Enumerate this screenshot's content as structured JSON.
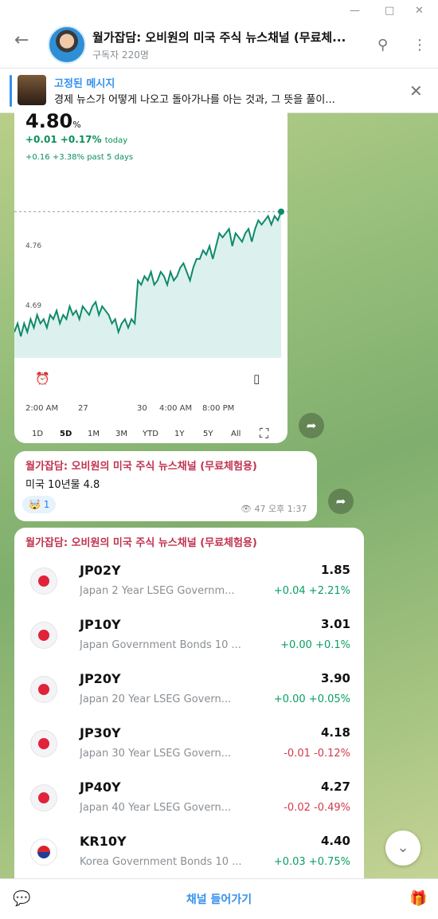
{
  "header": {
    "title": "월가잡담: 오비원의 미국 주식 뉴스채널 (무료체...",
    "subscribers": "구독자 220명"
  },
  "pinned": {
    "title": "고정된 메시지",
    "text": "경제 뉴스가 어떻게 나오고 돌아가나를 아는 것과, 그 뜻을 풀이..."
  },
  "chart_card": {
    "value": "4.80",
    "unit": "%",
    "today_change": "+0.01",
    "today_pct": "+0.17%",
    "today_label": "today",
    "past_change": "+0.16",
    "past_pct": "+3.38%",
    "past_label": "past 5 days",
    "periods": [
      "1D",
      "5D",
      "1M",
      "3M",
      "YTD",
      "1Y",
      "5Y",
      "All"
    ],
    "active_period": "5D"
  },
  "chart_data": {
    "type": "area",
    "title": "",
    "xlabel": "",
    "ylabel": "",
    "x_tick_labels": [
      "2:00 AM",
      "27",
      "30",
      "4:00 AM",
      "8:00 PM"
    ],
    "y_tick_labels": [
      "4.76",
      "4.69"
    ],
    "ylim": [
      4.63,
      4.82
    ],
    "reference_line": 4.8,
    "series": [
      {
        "values": [
          4.66,
          4.67,
          4.655,
          4.67,
          4.66,
          4.675,
          4.665,
          4.68,
          4.67,
          4.675,
          4.665,
          4.68,
          4.675,
          4.685,
          4.67,
          4.68,
          4.675,
          4.69,
          4.68,
          4.685,
          4.675,
          4.69,
          4.685,
          4.68,
          4.69,
          4.695,
          4.68,
          4.69,
          4.685,
          4.68,
          4.67,
          4.675,
          4.66,
          4.67,
          4.675,
          4.665,
          4.675,
          4.67,
          4.72,
          4.715,
          4.725,
          4.72,
          4.73,
          4.715,
          4.72,
          4.73,
          4.725,
          4.715,
          4.73,
          4.72,
          4.725,
          4.735,
          4.74,
          4.73,
          4.72,
          4.735,
          4.745,
          4.745,
          4.755,
          4.75,
          4.76,
          4.745,
          4.76,
          4.775,
          4.77,
          4.775,
          4.78,
          4.76,
          4.775,
          4.77,
          4.765,
          4.775,
          4.78,
          4.765,
          4.78,
          4.79,
          4.785,
          4.79,
          4.795,
          4.785,
          4.795,
          4.79,
          4.8
        ]
      }
    ]
  },
  "post1": {
    "author": "월가잡담: 오비원의 미국 주식 뉴스채널 (무료체험용)",
    "text": "미국 10년물 4.8",
    "reaction_emoji": "🤯",
    "reaction_count": "1",
    "views": "47",
    "time": "오후 1:37"
  },
  "post2": {
    "author": "월가잡담: 오비원의 미국 주식 뉴스채널 (무료체험용)",
    "rows": [
      {
        "flag": "jp",
        "symbol": "JP02Y",
        "name": "Japan 2 Year LSEG Governm...",
        "value": "1.85",
        "change": "+0.04",
        "pct": "+2.21%",
        "dir": "pos"
      },
      {
        "flag": "jp",
        "symbol": "JP10Y",
        "name": "Japan Government Bonds 10 ...",
        "value": "3.01",
        "change": "+0.00",
        "pct": "+0.1%",
        "dir": "pos"
      },
      {
        "flag": "jp",
        "symbol": "JP20Y",
        "name": "Japan 20 Year LSEG Govern...",
        "value": "3.90",
        "change": "+0.00",
        "pct": "+0.05%",
        "dir": "pos"
      },
      {
        "flag": "jp",
        "symbol": "JP30Y",
        "name": "Japan 30 Year LSEG Govern...",
        "value": "4.18",
        "change": "-0.01",
        "pct": "-0.12%",
        "dir": "neg"
      },
      {
        "flag": "jp",
        "symbol": "JP40Y",
        "name": "Japan 40 Year LSEG Govern...",
        "value": "4.27",
        "change": "-0.02",
        "pct": "-0.49%",
        "dir": "neg"
      },
      {
        "flag": "kr",
        "symbol": "KR10Y",
        "name": "Korea Government Bonds 10 ...",
        "value": "4.40",
        "change": "+0.03",
        "pct": "+0.75%",
        "dir": "pos"
      }
    ]
  },
  "bottom": {
    "join_label": "채널 들어가기"
  },
  "colors": {
    "accent": "#3390ec",
    "author": "#c0334f",
    "positive": "#0a9e63",
    "negative": "#d23a4a",
    "chart_line": "#108a6a"
  }
}
